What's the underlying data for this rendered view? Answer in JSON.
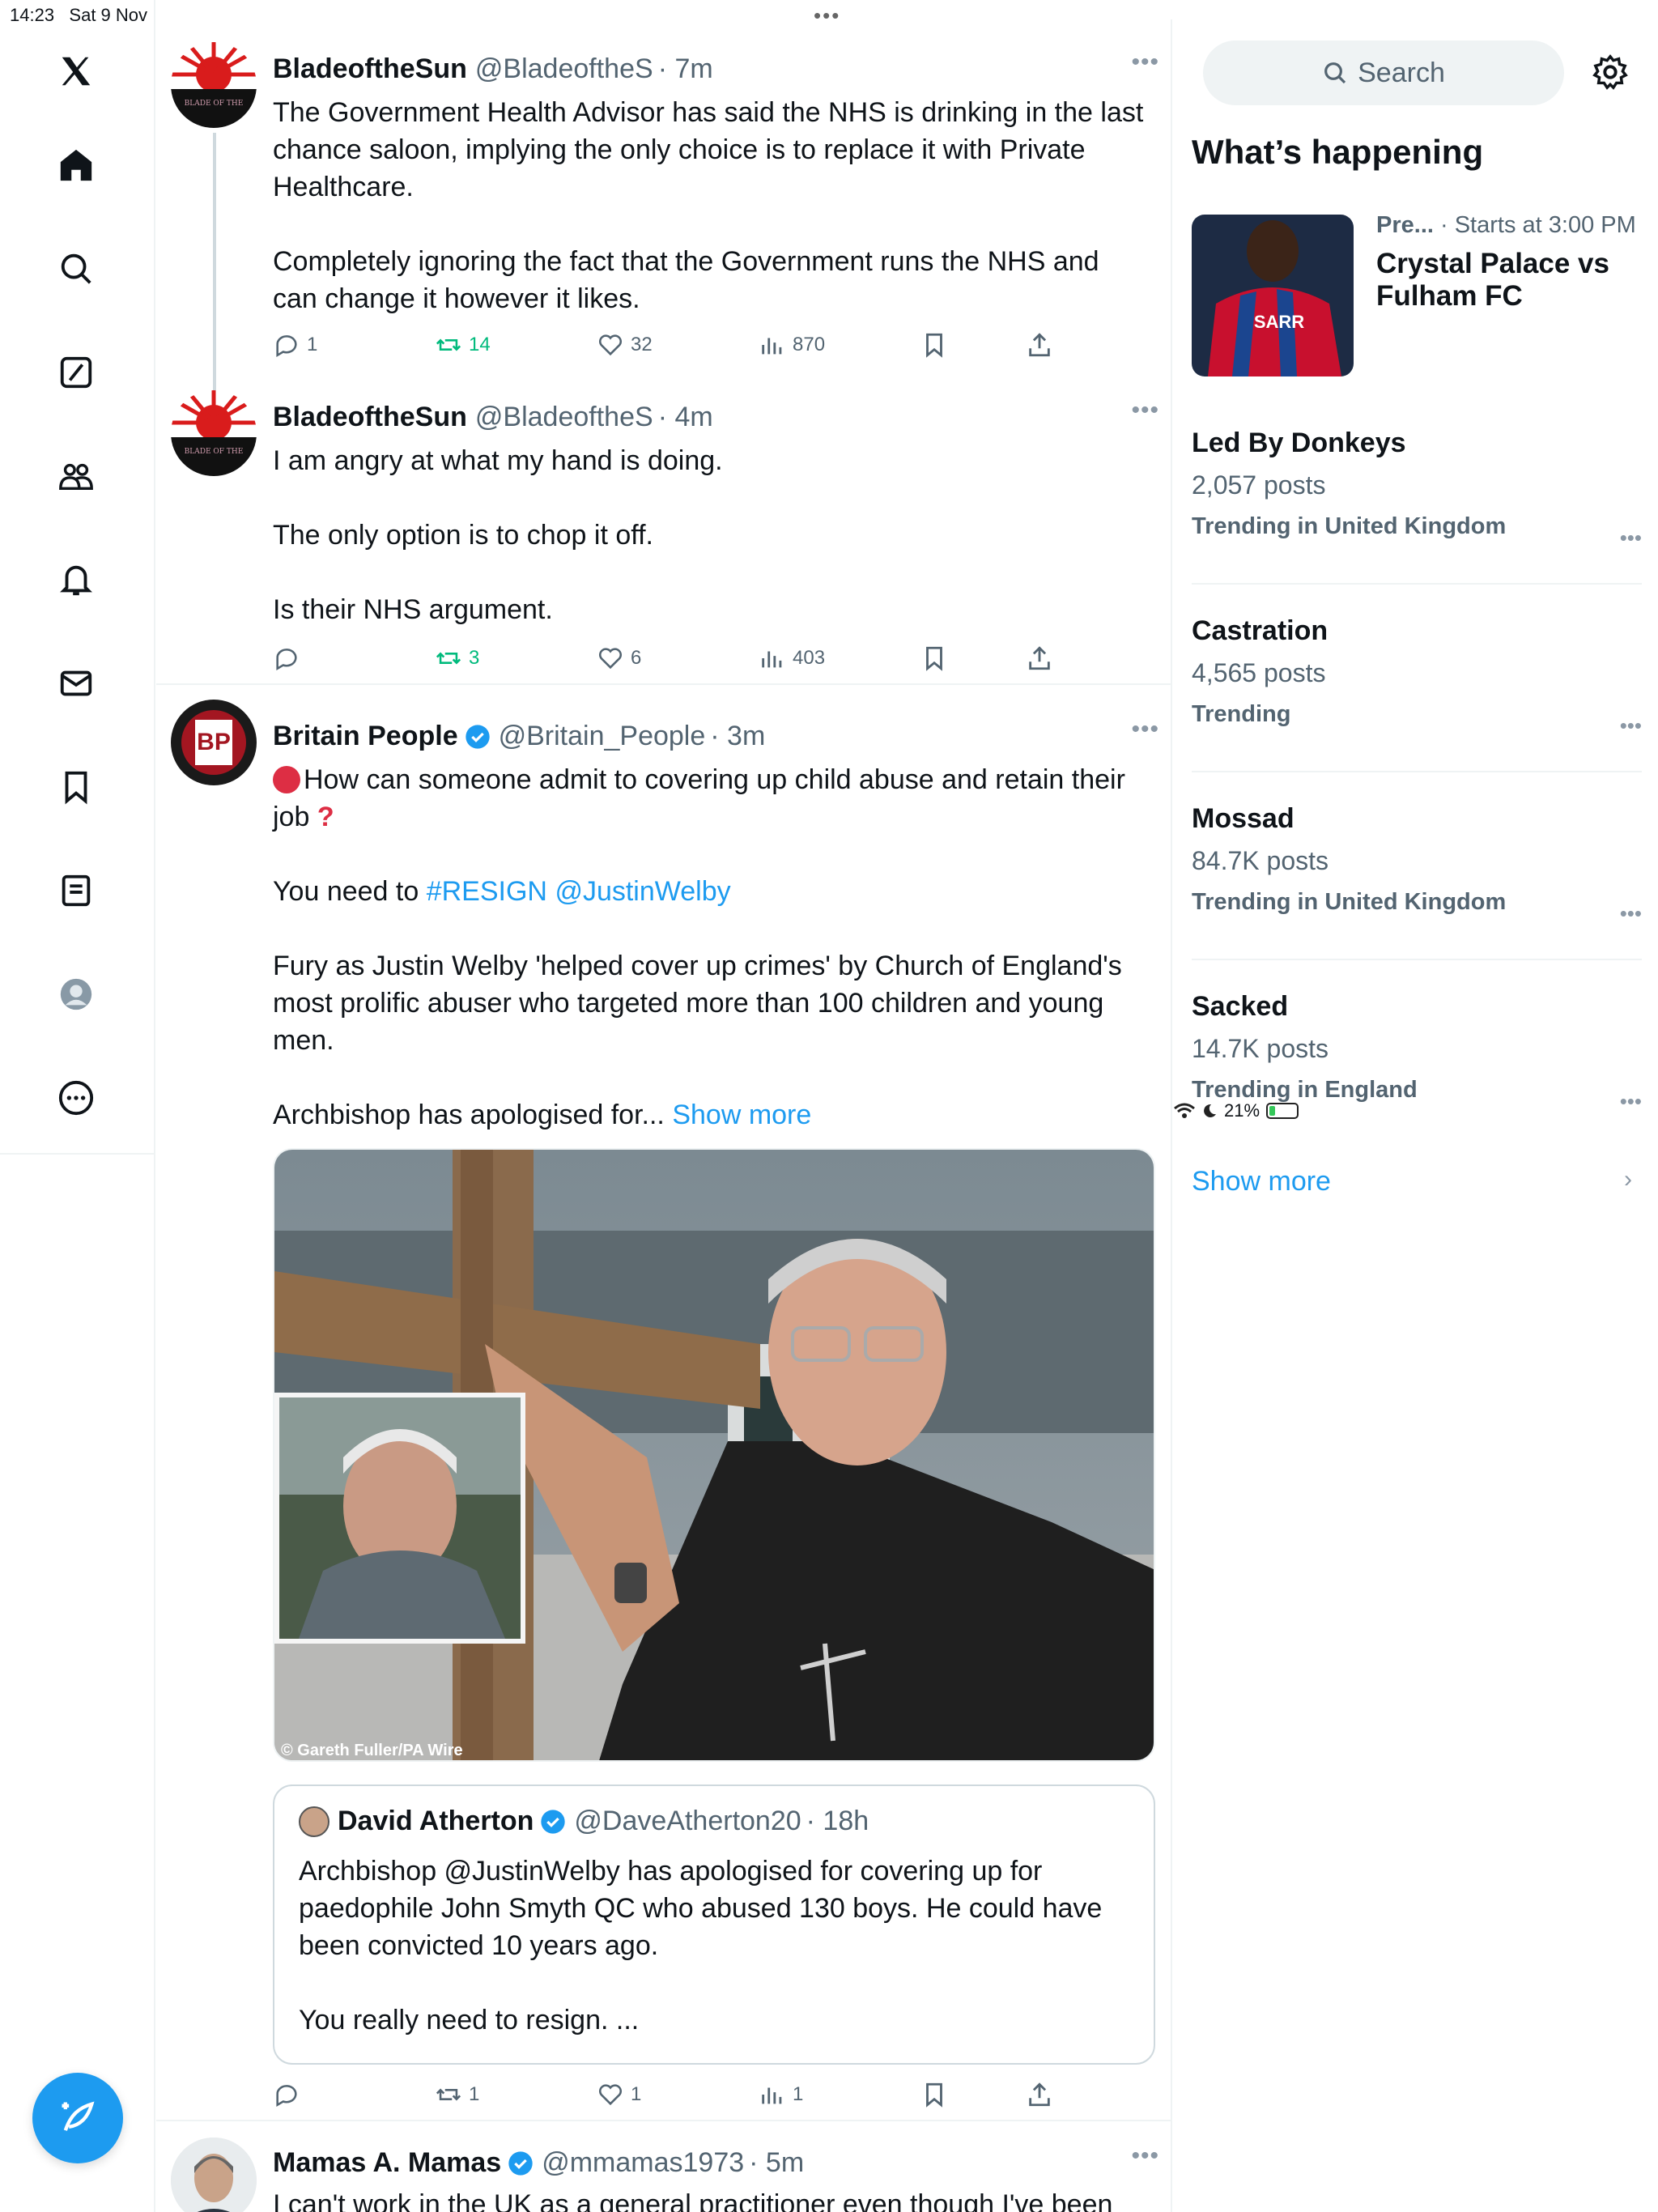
{
  "status": {
    "time": "14:23",
    "date": "Sat 9 Nov",
    "battery": "21%",
    "battery_level": 0.21
  },
  "nav": [
    "x-logo",
    "home",
    "explore",
    "grok",
    "communities",
    "notifications",
    "messages",
    "bookmarks",
    "lists",
    "profile",
    "more"
  ],
  "posts": [
    {
      "name": "BladeoftheSun",
      "handle": "@BladeoftheS",
      "time": "· 7m",
      "avatar_text": "BLADE OF THE",
      "paragraphs": [
        "The Government Health Advisor has said the NHS is drinking in the last chance saloon, implying the only choice is to replace it with Private Healthcare.",
        "",
        "Completely ignoring the fact that the Government runs the NHS and can change it however it likes."
      ],
      "replies": "1",
      "reposts": "14",
      "likes": "32",
      "views": "870"
    },
    {
      "name": "BladeoftheSun",
      "handle": "@BladeoftheS",
      "time": "· 4m",
      "avatar_text": "BLADE OF THE",
      "paragraphs": [
        "I am angry at what my hand is doing.",
        "",
        "The only option is to chop it off.",
        "",
        "Is their NHS argument."
      ],
      "replies": "",
      "reposts": "3",
      "likes": "6",
      "views": "403"
    },
    {
      "name": "Britain People",
      "handle": "@Britain_People",
      "time": "· 3m",
      "avatar_text": "BP",
      "line1": "How can someone admit to covering up child abuse and retain their job",
      "line2_prefix": "You need to ",
      "hashtag": "#RESIGN",
      "mention": "@JustinWelby",
      "line3": "Fury as Justin Welby 'helped cover up crimes' by Church of England's most prolific abuser who targeted more than 100 children and young men.",
      "line4": "Archbishop has apologised for...",
      "show_more": "Show more",
      "image_credit": "© Gareth Fuller/PA Wire",
      "quote": {
        "name": "David Atherton",
        "handle": "@DaveAtherton20",
        "time": "· 18h",
        "text1": "Archbishop @JustinWelby has apologised for covering up for paedophile John Smyth QC who abused 130 boys. He could have been convicted 10 years ago.",
        "text2": "You really need to resign. ..."
      },
      "replies": "",
      "reposts": "1",
      "likes": "1",
      "views": "1"
    },
    {
      "name": "Mamas A. Mamas",
      "handle": "@mmamas1973",
      "time": "· 5m",
      "text": "I can't work in the UK as a general practitioner even though I've been"
    }
  ],
  "right": {
    "search_placeholder": "Search",
    "whats_happening": "What’s happening",
    "event": {
      "category": "Pre...",
      "time": "· Starts at 3:00 PM",
      "title": "Crystal Palace vs Fulham FC",
      "shirt_text": "SARR"
    },
    "trends": [
      {
        "name": "Led By Donkeys",
        "count": "2,057 posts",
        "context": "Trending in United Kingdom"
      },
      {
        "name": "Castration",
        "count": "4,565 posts",
        "context": "Trending"
      },
      {
        "name": "Mossad",
        "count": "84.7K posts",
        "context": "Trending in United Kingdom"
      },
      {
        "name": "Sacked",
        "count": "14.7K posts",
        "context": "Trending in England"
      }
    ],
    "show_more": "Show more"
  },
  "colors": {
    "accent": "#1d9bf0",
    "repost": "#00ba7c",
    "secondary_text": "#536471",
    "divider": "#eff3f4"
  }
}
